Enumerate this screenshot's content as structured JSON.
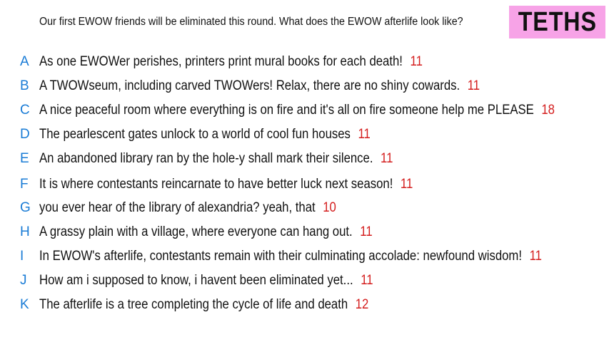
{
  "prompt": "Our first EWOW friends will be eliminated this round. What does the EWOW afterlife look like?",
  "tag": "TETHS",
  "colors": {
    "letter": "#1a7cd6",
    "count": "#d41e1e",
    "tag_bg": "#f7a3e7"
  },
  "responses": [
    {
      "letter": "A",
      "text": "As one EWOWer perishes, printers print mural books for each death!",
      "count": "11"
    },
    {
      "letter": "B",
      "text": "A TWOWseum, including carved TWOWers! Relax, there are no shiny cowards.",
      "count": "11"
    },
    {
      "letter": "C",
      "text": "A nice peaceful room where everything is on fire and it's all on fire someone help me PLEASE",
      "count": "18"
    },
    {
      "letter": "D",
      "text": "The pearlescent gates unlock to a world of cool fun houses",
      "count": "11"
    },
    {
      "letter": "E",
      "text": "An abandoned library ran by the hole-y shall mark their silence.",
      "count": "11"
    },
    {
      "letter": "F",
      "text": "It is where contestants reincarnate to have better luck next season!",
      "count": "11"
    },
    {
      "letter": "G",
      "text": "you ever hear of the library of alexandria? yeah, that",
      "count": "10"
    },
    {
      "letter": "H",
      "text": "A grassy plain with a village, where everyone can hang out.",
      "count": "11"
    },
    {
      "letter": "I",
      "text": "In EWOW's afterlife, contestants remain with their culminating accolade: newfound wisdom!",
      "count": "11"
    },
    {
      "letter": "J",
      "text": "How am i supposed to know, i havent been eliminated yet...",
      "count": "11"
    },
    {
      "letter": "K",
      "text": "The afterlife is a tree completing the cycle of life and death",
      "count": "12"
    }
  ]
}
